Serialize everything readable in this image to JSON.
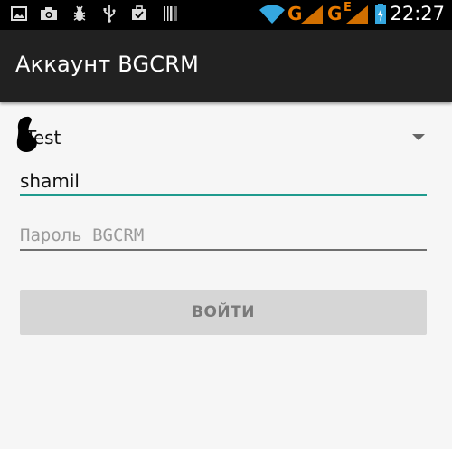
{
  "status_bar": {
    "time": "22:27",
    "icons": [
      "image-icon",
      "camera-icon",
      "debug-bug-icon",
      "usb-icon",
      "briefcase-icon",
      "barcode-icon",
      "wifi-icon",
      "signal-icon",
      "battery-charging-icon"
    ],
    "network_labels": {
      "g1": "G",
      "g2": "G",
      "e": "E"
    },
    "colors": {
      "network": "#e87b00",
      "wifi": "#35a7e0",
      "battery": "#35a7e0"
    }
  },
  "app_bar": {
    "title": "Аккаунт BGCRM"
  },
  "form": {
    "server_select": {
      "value": "Test"
    },
    "login": {
      "value": "shamil"
    },
    "password": {
      "placeholder": "Пароль BGCRM"
    },
    "submit_label": "ВОЙТИ"
  },
  "colors": {
    "app_bar": "#212121",
    "accent_underline": "#1f9b8e",
    "background": "#f6f6f6",
    "button_bg": "#d6d6d6",
    "button_text": "#7a7a7a"
  }
}
